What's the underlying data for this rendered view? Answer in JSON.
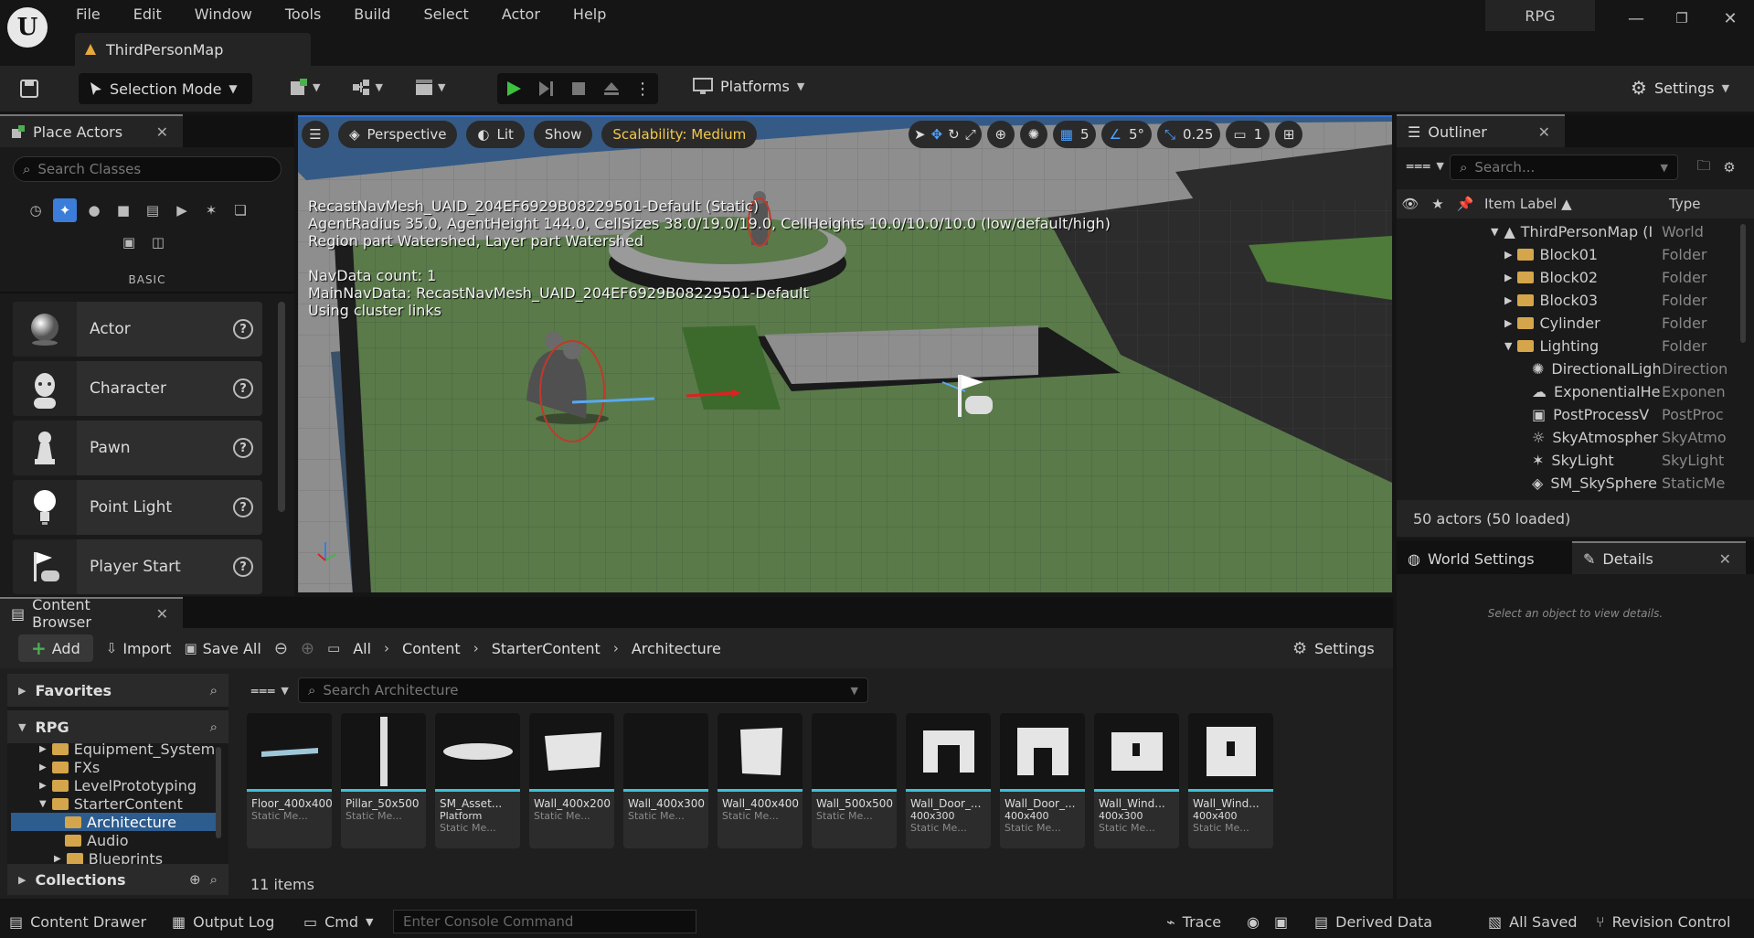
{
  "app": {
    "project": "RPG",
    "map_tab": "ThirdPersonMap"
  },
  "menu": [
    "File",
    "Edit",
    "Window",
    "Tools",
    "Build",
    "Select",
    "Actor",
    "Help"
  ],
  "toolbar": {
    "mode": "Selection Mode",
    "platforms": "Platforms",
    "settings": "Settings"
  },
  "place_actors": {
    "title": "Place Actors",
    "search_placeholder": "Search Classes",
    "category": "BASIC",
    "items": [
      {
        "label": "Actor",
        "icon": "sphere-icon"
      },
      {
        "label": "Character",
        "icon": "character-icon"
      },
      {
        "label": "Pawn",
        "icon": "pawn-icon"
      },
      {
        "label": "Point Light",
        "icon": "lightbulb-icon"
      },
      {
        "label": "Player Start",
        "icon": "player-start-icon"
      }
    ]
  },
  "viewport": {
    "perspective": "Perspective",
    "lit": "Lit",
    "show": "Show",
    "scalability": "Scalability: Medium",
    "grid_snap": "5",
    "rot_snap": "5°",
    "scale_snap": "0.25",
    "camera_speed": "1",
    "overlay": [
      "RecastNavMesh_UAID_204EF6929B08229501-Default (Static)",
      "AgentRadius 35.0, AgentHeight 144.0, CellSizes 38.0/19.0/19.0, CellHeights 10.0/10.0/10.0 (low/default/high)",
      "Region part Watershed, Layer part Watershed",
      "",
      "NavData count: 1",
      "MainNavData: RecastNavMesh_UAID_204EF6929B08229501-Default",
      "Using cluster links"
    ]
  },
  "outliner": {
    "title": "Outliner",
    "search_placeholder": "Search...",
    "col_label": "Item Label ▲",
    "col_type": "Type",
    "rows": [
      {
        "label": "ThirdPersonMap (I",
        "type": "World"
      },
      {
        "label": "Block01",
        "type": "Folder"
      },
      {
        "label": "Block02",
        "type": "Folder"
      },
      {
        "label": "Block03",
        "type": "Folder"
      },
      {
        "label": "Cylinder",
        "type": "Folder"
      },
      {
        "label": "Lighting",
        "type": "Folder"
      },
      {
        "label": "DirectionalLigh",
        "type": "Direction"
      },
      {
        "label": "ExponentialHe",
        "type": "Exponen"
      },
      {
        "label": "PostProcessV",
        "type": "PostProc"
      },
      {
        "label": "SkyAtmospher",
        "type": "SkyAtmo"
      },
      {
        "label": "SkyLight",
        "type": "SkyLight"
      },
      {
        "label": "SM_SkySphere",
        "type": "StaticMe"
      }
    ],
    "status": "50 actors (50 loaded)"
  },
  "details": {
    "world_settings": "World Settings",
    "title": "Details",
    "empty": "Select an object to view details."
  },
  "content_browser": {
    "title": "Content Browser",
    "add": "Add",
    "import": "Import",
    "save_all": "Save All",
    "breadcrumb": [
      "All",
      "Content",
      "StarterContent",
      "Architecture"
    ],
    "settings": "Settings",
    "favorites": "Favorites",
    "root": "RPG",
    "tree": [
      "Equipment_System",
      "FXs",
      "LevelPrototyping",
      "StarterContent",
      "Architecture",
      "Audio",
      "Blueprints"
    ],
    "collections": "Collections",
    "search_placeholder": "Search Architecture",
    "assets": [
      {
        "name": "Floor_400x400",
        "sub": "",
        "type": "Static Me..."
      },
      {
        "name": "Pillar_50x500",
        "sub": "",
        "type": "Static Me..."
      },
      {
        "name": "SM_Asset...",
        "sub": "Platform",
        "type": "Static Me..."
      },
      {
        "name": "Wall_400x200",
        "sub": "",
        "type": "Static Me..."
      },
      {
        "name": "Wall_400x300",
        "sub": "",
        "type": "Static Me..."
      },
      {
        "name": "Wall_400x400",
        "sub": "",
        "type": "Static Me..."
      },
      {
        "name": "Wall_500x500",
        "sub": "",
        "type": "Static Me..."
      },
      {
        "name": "Wall_Door_...",
        "sub": "400x300",
        "type": "Static Me..."
      },
      {
        "name": "Wall_Door_...",
        "sub": "400x400",
        "type": "Static Me..."
      },
      {
        "name": "Wall_Wind...",
        "sub": "400x300",
        "type": "Static Me..."
      },
      {
        "name": "Wall_Wind...",
        "sub": "400x400",
        "type": "Static Me..."
      }
    ],
    "count": "11 items"
  },
  "statusbar": {
    "content_drawer": "Content Drawer",
    "output_log": "Output Log",
    "cmd": "Cmd",
    "console_placeholder": "Enter Console Command",
    "trace": "Trace",
    "derived_data": "Derived Data",
    "all_saved": "All Saved",
    "revision_control": "Revision Control"
  },
  "colors": {
    "accent": "#4ea1ff",
    "play": "#3ec13e",
    "scalability": "#f2c94c",
    "selection": "#2d5c8f",
    "cyan": "#3ac2d6"
  }
}
